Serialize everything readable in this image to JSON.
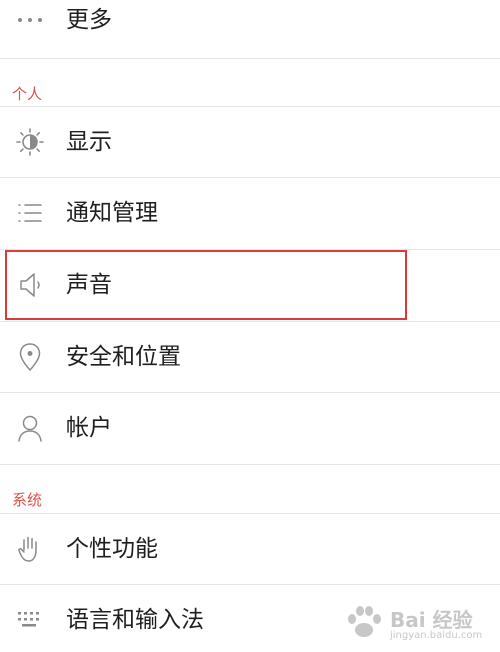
{
  "menu": {
    "more": {
      "label": "更多",
      "icon": "more-dots-icon"
    }
  },
  "sections": {
    "personal": {
      "header": "个人",
      "items": [
        {
          "label": "显示",
          "icon": "brightness-icon"
        },
        {
          "label": "通知管理",
          "icon": "list-icon"
        },
        {
          "label": "声音",
          "icon": "speaker-icon"
        },
        {
          "label": "安全和位置",
          "icon": "location-pin-icon"
        },
        {
          "label": "帐户",
          "icon": "user-icon"
        }
      ]
    },
    "system": {
      "header": "系统",
      "items": [
        {
          "label": "个性功能",
          "icon": "hand-icon"
        },
        {
          "label": "语言和输入法",
          "icon": "keyboard-icon"
        }
      ]
    }
  },
  "watermark": {
    "text": "Bai 经验",
    "sub": "jingyan.baidu.com"
  },
  "colors": {
    "section_header": "#d9534f",
    "highlight": "#d93a3a",
    "icon": "#8a8a8a",
    "text": "#1f1f1f"
  }
}
